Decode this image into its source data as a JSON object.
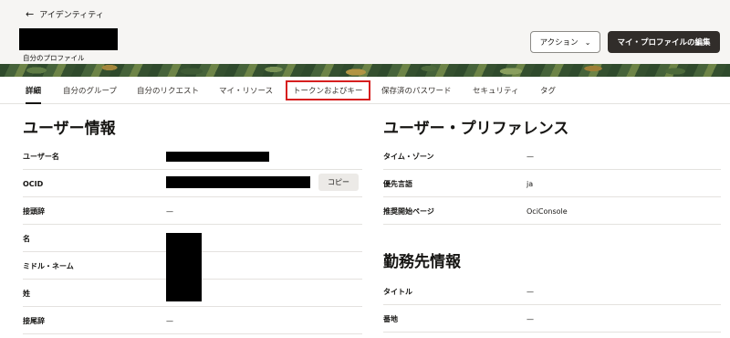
{
  "header": {
    "back_label": "アイデンティティ",
    "profile_subtitle": "自分のプロファイル",
    "action_button": "アクション",
    "edit_button": "マイ・プロファイルの編集"
  },
  "tabs": [
    {
      "label": "詳細"
    },
    {
      "label": "自分のグループ"
    },
    {
      "label": "自分のリクエスト"
    },
    {
      "label": "マイ・リソース"
    },
    {
      "label": "トークンおよびキー"
    },
    {
      "label": "保存済のパスワード"
    },
    {
      "label": "セキュリティ"
    },
    {
      "label": "タグ"
    }
  ],
  "user_info": {
    "title": "ユーザー情報",
    "copy_label": "コピー",
    "rows": [
      {
        "label": "ユーザー名",
        "value": ""
      },
      {
        "label": "OCID",
        "value": ""
      },
      {
        "label": "接頭辞",
        "value": "—"
      },
      {
        "label": "名",
        "value": ""
      },
      {
        "label": "ミドル・ネーム",
        "value": ""
      },
      {
        "label": "姓",
        "value": ""
      },
      {
        "label": "接尾辞",
        "value": "—"
      }
    ]
  },
  "preferences": {
    "title": "ユーザー・プリファレンス",
    "rows": [
      {
        "label": "タイム・ゾーン",
        "value": "—"
      },
      {
        "label": "優先言語",
        "value": "ja"
      },
      {
        "label": "推奨開始ページ",
        "value": "OciConsole"
      }
    ]
  },
  "work_info": {
    "title": "勤務先情報",
    "rows": [
      {
        "label": "タイトル",
        "value": "—"
      },
      {
        "label": "番地",
        "value": "—"
      }
    ]
  }
}
